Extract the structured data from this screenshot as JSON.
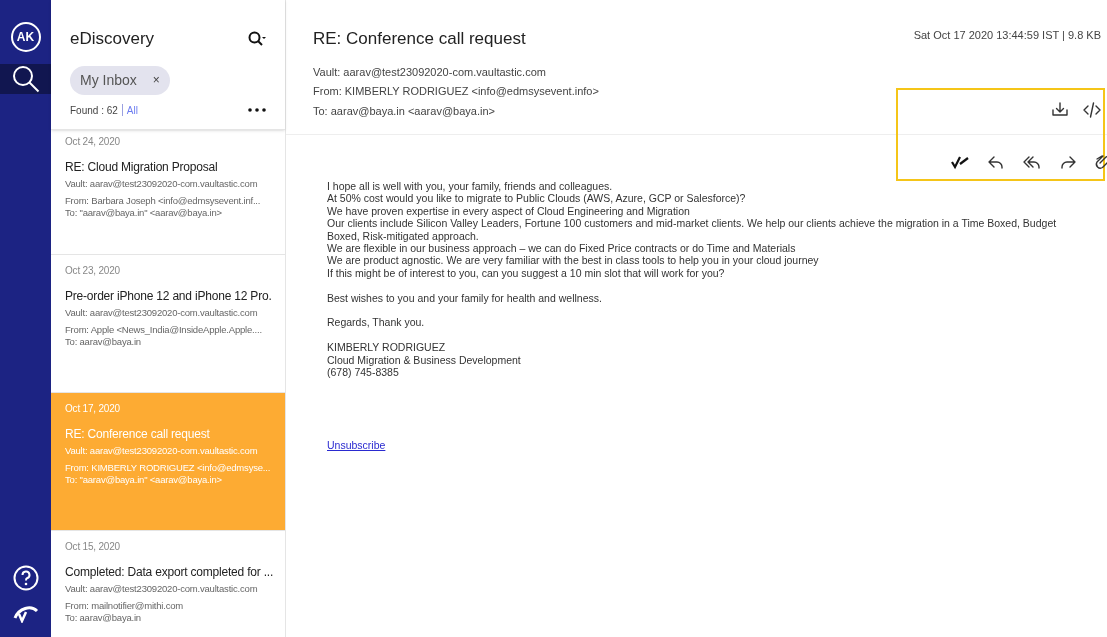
{
  "nav": {
    "avatar": "AK",
    "items": [
      {
        "kind": "search",
        "selected": true
      },
      {
        "kind": "help",
        "selected": false
      },
      {
        "kind": "logo",
        "selected": false
      }
    ]
  },
  "list_panel": {
    "title": "eDiscovery",
    "filter_chip": "My Inbox",
    "chip_close": "×",
    "found": "Found : 62",
    "all_link": "All",
    "messages": [
      {
        "date": "Oct 24, 2020",
        "subject": "RE: Cloud Migration Proposal",
        "vault": "Vault: aarav@test23092020-com.vaultastic.com",
        "from": "From: Barbara Joseph <info@edmsysevent.inf...",
        "to": "To: \"aarav@baya.in\" <aarav@baya.in>",
        "selected": false
      },
      {
        "date": "Oct 23, 2020",
        "subject": "Pre-order iPhone 12 and iPhone 12 Pro.",
        "vault": "Vault: aarav@test23092020-com.vaultastic.com",
        "from": "From: Apple <News_India@InsideApple.Apple....",
        "to": "To: aarav@baya.in",
        "selected": false
      },
      {
        "date": "Oct 17, 2020",
        "subject": "RE: Conference call request",
        "vault": "Vault: aarav@test23092020-com.vaultastic.com",
        "from": "From: KIMBERLY RODRIGUEZ <info@edmsyse...",
        "to": "To: \"aarav@baya.in\" <aarav@baya.in>",
        "selected": true
      },
      {
        "date": "Oct 15, 2020",
        "subject": "Completed: Data export completed for ...",
        "vault": "Vault: aarav@test23092020-com.vaultastic.com",
        "from": "From: mailnotifier@mithi.com",
        "to": "To: aarav@baya.in",
        "selected": false
      }
    ]
  },
  "message": {
    "subject": "RE: Conference call request",
    "meta": "Sat Oct 17 2020 13:44:59 IST | 9.8 KB",
    "vault": "Vault: aarav@test23092020-com.vaultastic.com",
    "from": "From: KIMBERLY RODRIGUEZ <info@edmsysevent.info>",
    "to": "To: aarav@baya.in <aarav@baya.in>",
    "top_actions": [
      {
        "kind": "download"
      },
      {
        "kind": "source"
      }
    ],
    "actions": [
      {
        "kind": "mark"
      },
      {
        "kind": "reply"
      },
      {
        "kind": "reply-all"
      },
      {
        "kind": "forward"
      },
      {
        "kind": "attachment"
      }
    ],
    "body": [
      [
        "I hope all is well with you, your family, friends and colleagues.",
        "At 50% cost would you like to migrate to Public Clouds (AWS, Azure, GCP or Salesforce)?",
        "We have proven expertise in every aspect of Cloud Engineering and Migration",
        "Our clients include Silicon Valley Leaders, Fortune 100 customers and mid-market clients. We help our clients achieve the migration in a Time Boxed, Budget Boxed, Risk-mitigated approach.",
        "We are flexible in our business approach – we can do Fixed Price contracts or do Time and Materials",
        "We are product agnostic. We are very familiar with the best in class tools to help you in your cloud journey",
        "If this might be of interest to you, can you suggest a 10 min slot that will work for you?"
      ],
      [
        "Best wishes to you and your family for health and wellness."
      ],
      [
        "Regards, Thank you."
      ],
      [
        "KIMBERLY RODRIGUEZ",
        "Cloud Migration & Business Development",
        "(678) 745-8385"
      ]
    ],
    "unsubscribe": "Unsubscribe"
  }
}
